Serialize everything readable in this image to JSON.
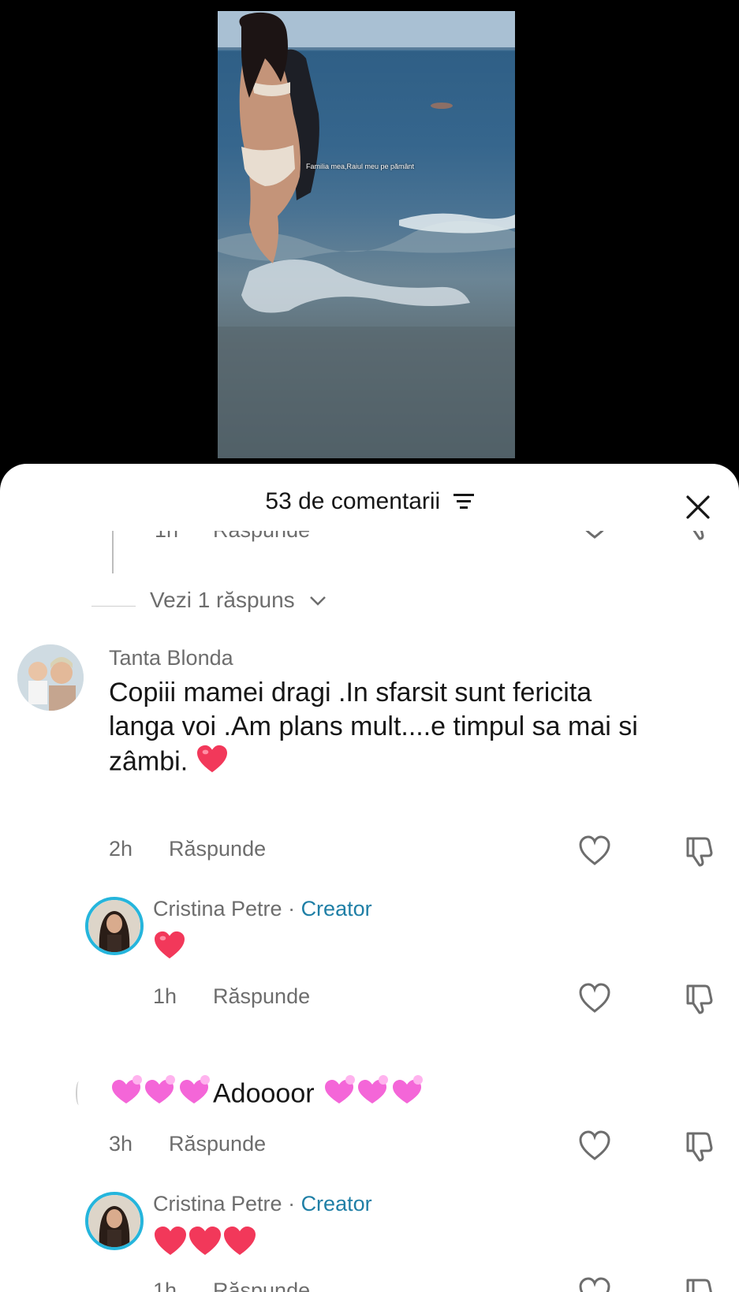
{
  "video": {
    "caption": "Familia mea,Raiul meu pe pământ"
  },
  "sheet": {
    "title": "53 de comentarii"
  },
  "colors": {
    "creator_ring": "#25b5dc",
    "creator_label": "#1f7fa6",
    "heart_red": "#f2385a",
    "heart_pink": "#f466d8"
  },
  "partial_reply": {
    "time": "1h",
    "reply_label": "Răspunde"
  },
  "view_replies": {
    "label": "Vezi 1 răspuns"
  },
  "comments": [
    {
      "author": "Tanta Blonda",
      "text_line1": "Copiii mamei dragi .In sfarsit sunt fericita",
      "text_line2": "langa voi .Am plans mult....e timpul sa mai si",
      "text_line3": "zâmbi.",
      "emoji": "red-heart",
      "time": "2h",
      "reply_label": "Răspunde"
    },
    {
      "author": "Cristina Petre",
      "separator": " · ",
      "badge": "Creator",
      "emoji": "red-heart",
      "time": "1h",
      "reply_label": "Răspunde"
    },
    {
      "text": "Adoooor",
      "emoji_before": "revolving-hearts x3",
      "emoji_after": "revolving-hearts x3",
      "time": "3h",
      "reply_label": "Răspunde"
    },
    {
      "author": "Cristina Petre",
      "separator": " · ",
      "badge": "Creator",
      "emoji": "red-heart x3",
      "time": "1h",
      "reply_label": "Răspunde"
    }
  ],
  "icons": [
    "filter-icon",
    "close-icon",
    "heart-outline-icon",
    "thumbs-down-icon",
    "chevron-down-icon"
  ]
}
